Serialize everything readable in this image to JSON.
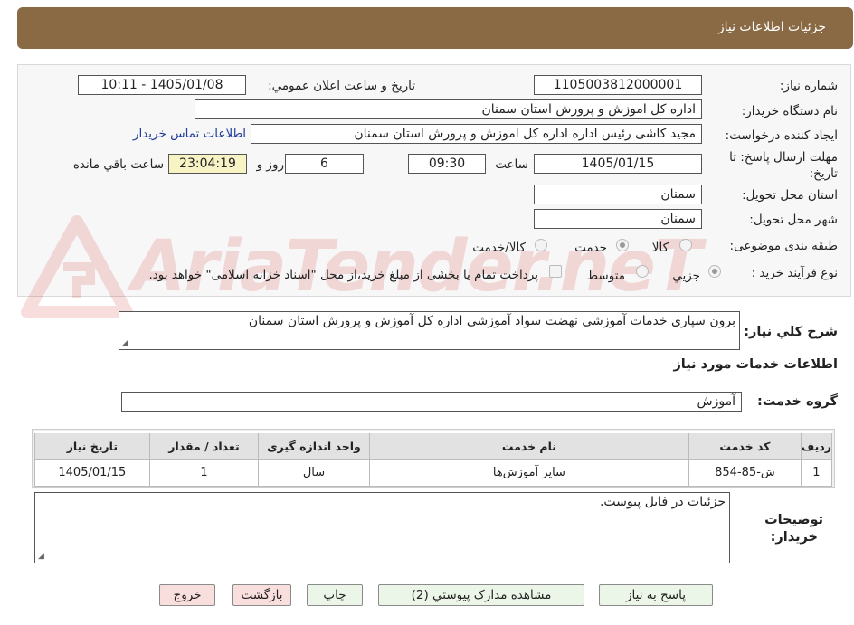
{
  "header": {
    "title": "جزئيات اطلاعات نياز"
  },
  "form": {
    "need_number_label": "شماره نياز:",
    "need_number": "1105003812000001",
    "announce_label": "تاريخ و ساعت اعلان عمومي:",
    "announce_value": "1405/01/08 - 10:11",
    "buyer_org_label": "نام دستگاه خريدار:",
    "buyer_org": "اداره کل اموزش و پرورش استان سمنان",
    "creator_label": "ايجاد کننده درخواست:",
    "creator": "مجيد کاشی رئيس اداره اداره کل اموزش و پرورش استان سمنان",
    "contact_link": "اطلاعات تماس خريدار",
    "deadline_label_1": "مهلت ارسال پاسخ: تا",
    "deadline_label_2": "تاريخ:",
    "deadline_date": "1405/01/15",
    "time_label": "ساعت",
    "deadline_time": "09:30",
    "days_value": "6",
    "days_label": "روز و",
    "remaining_time": "23:04:19",
    "remaining_label": "ساعت باقي مانده",
    "province_label": "استان محل تحويل:",
    "province": "سمنان",
    "city_label": "شهر محل تحويل:",
    "city": "سمنان",
    "category_label": "طبقه بندی موضوعی:",
    "category_options": [
      "کالا",
      "خدمت",
      "کالا/خدمت"
    ],
    "category_selected": "خدمت",
    "process_label": "نوع فرآيند خريد :",
    "process_options": [
      "جزيي",
      "متوسط"
    ],
    "process_selected": "جزيي",
    "payment_note": "پرداخت تمام يا بخشی از مبلغ خريد،از محل \"اسناد خزانه اسلامی\" خواهد بود."
  },
  "watermark": {
    "text": "AriaTender.neT"
  },
  "description": {
    "label": "شرح کلي نياز:",
    "value": "برون سپاری خدمات آموزشی نهضت سواد آموزشی اداره کل آموزش و پرورش استان سمنان"
  },
  "services": {
    "title": "اطلاعات خدمات مورد نياز",
    "group_label": "گروه خدمت:",
    "group_value": "آموزش",
    "columns": [
      "رديف",
      "کد خدمت",
      "نام خدمت",
      "واحد اندازه گيری",
      "تعداد / مقدار",
      "تاريخ نياز"
    ],
    "rows": [
      {
        "row": "1",
        "code": "ش-85-854",
        "name": "ساير آموزش‌ها",
        "unit": "سال",
        "qty": "1",
        "date": "1405/01/15"
      }
    ]
  },
  "buyer_notes": {
    "label_1": "توضيحات",
    "label_2": "خريدار:",
    "value": "جزئيات در فايل پيوست."
  },
  "buttons": {
    "reply": "پاسخ به نياز",
    "attachments": "مشاهده مدارک پيوستي (2)",
    "print": "چاپ",
    "back": "بازگشت",
    "exit": "خروج"
  },
  "colors": {
    "header_bg": "#8a6a45",
    "link": "#1f3c99",
    "remaining_bg": "#f7f3c4"
  }
}
